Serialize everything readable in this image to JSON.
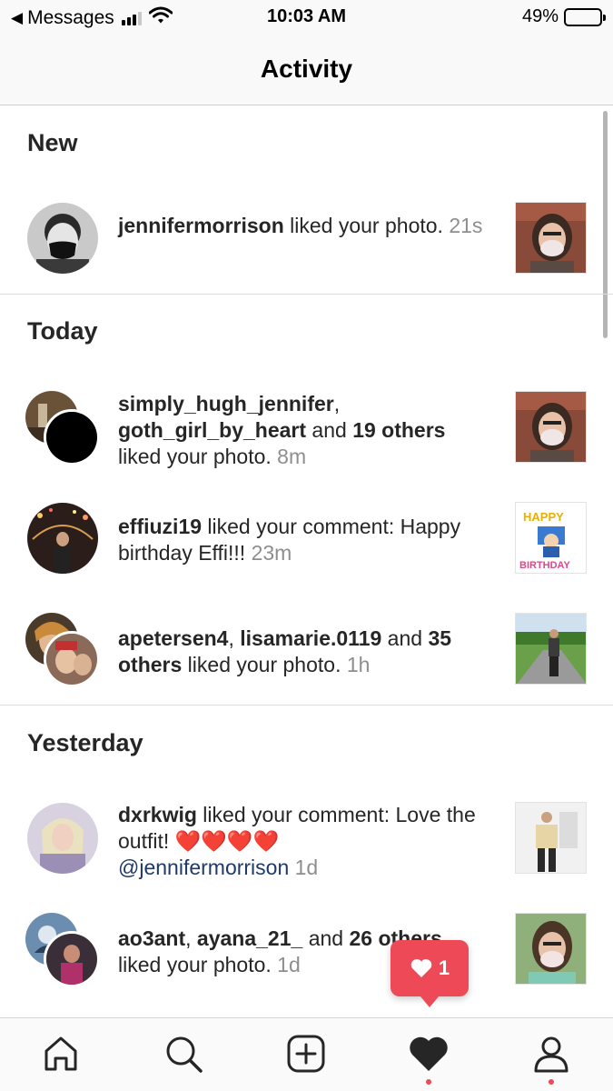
{
  "status_bar": {
    "back_label": "Messages",
    "time": "10:03 AM",
    "battery": "49%",
    "battery_level": 0.49
  },
  "header": {
    "title": "Activity"
  },
  "sections": {
    "new": "New",
    "today": "Today",
    "yesterday": "Yesterday"
  },
  "activity": {
    "r1": {
      "user": "jennifermorrison",
      "action": " liked your photo. ",
      "time": "21s"
    },
    "r2": {
      "user1": "simply_hugh_jennifer",
      "sep": ",",
      "user2": "goth_girl_by_heart",
      "and": " and ",
      "others": "19 others",
      "action": " liked your photo. ",
      "time": "8m"
    },
    "r3": {
      "user": "effiuzi19",
      "action": " liked your comment: Happy birthday Effi!!! ",
      "time": "23m"
    },
    "r4": {
      "user1": "apetersen4",
      "sep": ", ",
      "user2": "lisamarie.0119",
      "and": " and ",
      "others": "35 others",
      "action": " liked your photo. ",
      "time": "1h"
    },
    "r5": {
      "user": "dxrkwig",
      "action": " liked your comment: Love the outfit! ",
      "hearts": "❤️❤️❤️❤️",
      "mention": "@jennifermorrison",
      "time": "1d"
    },
    "r6": {
      "user1": "ao3ant",
      "sep": ", ",
      "user2": "ayana_21_",
      "and": " and ",
      "others": "26 others",
      "action": " liked your photo. ",
      "time": "1d"
    }
  },
  "thumb_text": {
    "happy": "HAPPY",
    "birthday": "BIRTHDAY"
  },
  "notification": {
    "count": "1"
  },
  "tabbar": {
    "items": [
      "home-icon",
      "search-icon",
      "new-post-icon",
      "activity-heart-icon",
      "profile-icon"
    ]
  },
  "colors": {
    "accent": "#ed4956",
    "time_gray": "#8e8e8e",
    "mention_blue": "#1e3a6a"
  }
}
